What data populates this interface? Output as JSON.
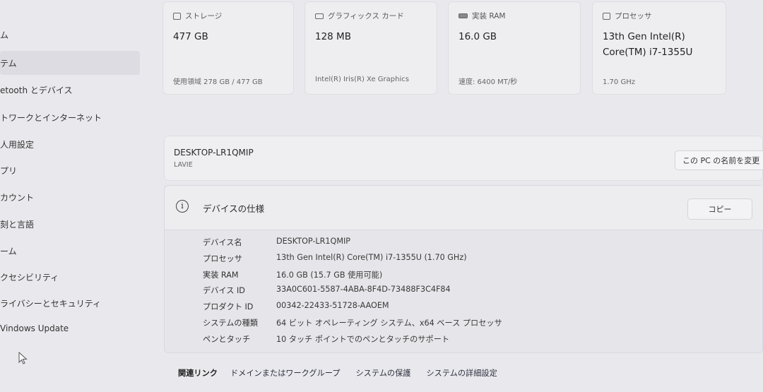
{
  "sidebar": {
    "items": [
      {
        "label": "ム",
        "selected": false
      },
      {
        "label": "テム",
        "selected": true
      },
      {
        "label": "etooth とデバイス",
        "selected": false
      },
      {
        "label": "トワークとインターネット",
        "selected": false
      },
      {
        "label": "人用設定",
        "selected": false
      },
      {
        "label": "プリ",
        "selected": false
      },
      {
        "label": "カウント",
        "selected": false
      },
      {
        "label": "刻と言語",
        "selected": false
      },
      {
        "label": "ーム",
        "selected": false
      },
      {
        "label": "クセシビリティ",
        "selected": false
      },
      {
        "label": "ライバシーとセキュリティ",
        "selected": false
      },
      {
        "label": "Vindows Update",
        "selected": false
      }
    ]
  },
  "cards": [
    {
      "title": "ストレージ",
      "icon": "storage-icon",
      "value": "477 GB",
      "sub": "使用領域 278 GB / 477 GB"
    },
    {
      "title": "グラフィックス カード",
      "icon": "graphics-card-icon",
      "value": "128 MB",
      "sub": "Intel(R) Iris(R) Xe Graphics"
    },
    {
      "title": "実装 RAM",
      "icon": "ram-icon",
      "value": "16.0 GB",
      "sub": "速度: 6400 MT/秒"
    },
    {
      "title": "プロセッサ",
      "icon": "processor-icon",
      "value": "13th Gen Intel(R)",
      "value2": "Core(TM) i7-1355U",
      "sub": "1.70 GHz"
    }
  ],
  "device": {
    "name": "DESKTOP-LR1QMIP",
    "model": "LAVIE",
    "rename_label": "この PC の名前を変更"
  },
  "specs": {
    "title": "デバイスの仕様",
    "copy_label": "コピー",
    "rows": [
      {
        "label": "デバイス名",
        "value": "DESKTOP-LR1QMIP"
      },
      {
        "label": "プロセッサ",
        "value": "13th Gen Intel(R) Core(TM) i7-1355U (1.70 GHz)"
      },
      {
        "label": "実装 RAM",
        "value": "16.0 GB (15.7 GB 使用可能)"
      },
      {
        "label": "デバイス ID",
        "value": "33A0C601-5587-4ABA-8F4D-73488F3C4F84"
      },
      {
        "label": "プロダクト ID",
        "value": "00342-22433-51728-AAOEM"
      },
      {
        "label": "システムの種類",
        "value": "64 ビット オペレーティング システム、x64 ベース プロセッサ"
      },
      {
        "label": "ペンとタッチ",
        "value": "10 タッチ ポイントでのペンとタッチのサポート"
      }
    ]
  },
  "related": {
    "title": "関連リンク",
    "links": [
      "ドメインまたはワークグループ",
      "システムの保護",
      "システムの詳細設定"
    ]
  },
  "colors": {
    "background": "#e9e9ed",
    "card": "#eeeef1",
    "selected_nav": "#dcdce2"
  }
}
